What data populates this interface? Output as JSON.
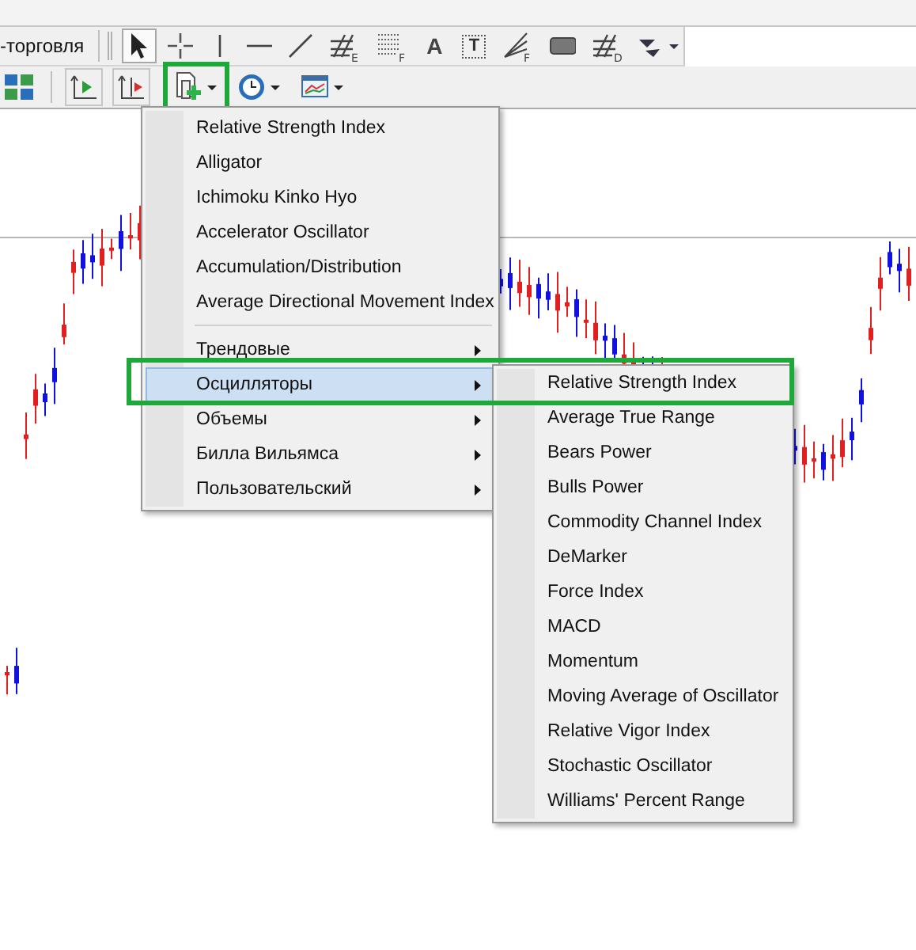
{
  "toolbar_top": {
    "label": "-торговля",
    "tools": [
      {
        "kind": "cursor",
        "selected": true
      },
      {
        "kind": "crosshair",
        "selected": false
      },
      {
        "kind": "vline",
        "selected": false
      },
      {
        "kind": "hline",
        "selected": false
      },
      {
        "kind": "trendline",
        "selected": false
      },
      {
        "kind": "channel",
        "glyph": "E",
        "selected": false
      },
      {
        "kind": "levels",
        "glyph": "F",
        "selected": false
      },
      {
        "kind": "text",
        "glyph": "A",
        "selected": false
      },
      {
        "kind": "label",
        "glyph": "T",
        "selected": false
      },
      {
        "kind": "fan",
        "glyph": "F",
        "selected": false
      },
      {
        "kind": "rect",
        "selected": false
      },
      {
        "kind": "grid",
        "glyph": "D",
        "selected": false
      },
      {
        "kind": "shapes",
        "selected": false
      }
    ]
  },
  "toolbar_bottom": {
    "tools": [
      {
        "kind": "tiles",
        "highlighted": false
      },
      {
        "kind": "autoscroll",
        "highlighted": false
      },
      {
        "kind": "shift",
        "highlighted": false
      },
      {
        "kind": "indicators",
        "highlighted": true
      },
      {
        "kind": "periods",
        "highlighted": false
      },
      {
        "kind": "templates",
        "highlighted": false
      }
    ]
  },
  "menu": {
    "items": [
      {
        "kind": "item",
        "label": "Relative Strength Index",
        "selected": false,
        "highlighted": false
      },
      {
        "kind": "item",
        "label": "Alligator",
        "selected": false,
        "highlighted": false
      },
      {
        "kind": "item",
        "label": "Ichimoku Kinko Hyo",
        "selected": false,
        "highlighted": false
      },
      {
        "kind": "item",
        "label": "Accelerator Oscillator",
        "selected": false,
        "highlighted": false
      },
      {
        "kind": "item",
        "label": "Accumulation/Distribution",
        "selected": false,
        "highlighted": false
      },
      {
        "kind": "item",
        "label": "Average Directional Movement Index",
        "selected": false,
        "highlighted": false
      },
      {
        "kind": "separator"
      },
      {
        "kind": "submenu",
        "label": "Трендовые",
        "selected": false,
        "highlighted": false
      },
      {
        "kind": "submenu",
        "label": "Осцилляторы",
        "selected": true,
        "highlighted": true
      },
      {
        "kind": "submenu",
        "label": "Объемы",
        "selected": false,
        "highlighted": false
      },
      {
        "kind": "submenu",
        "label": "Билла Вильямса",
        "selected": false,
        "highlighted": false
      },
      {
        "kind": "submenu",
        "label": "Пользовательский",
        "selected": false,
        "highlighted": false
      }
    ]
  },
  "submenu": {
    "items": [
      {
        "label": "Relative Strength Index",
        "selected": false
      },
      {
        "label": "Average True Range",
        "selected": false
      },
      {
        "label": "Bears Power",
        "selected": false
      },
      {
        "label": "Bulls Power",
        "selected": false
      },
      {
        "label": "Commodity Channel Index",
        "selected": false
      },
      {
        "label": "DeMarker",
        "selected": false
      },
      {
        "label": "Force Index",
        "selected": false
      },
      {
        "label": "MACD",
        "selected": false
      },
      {
        "label": "Momentum",
        "selected": false
      },
      {
        "label": "Moving Average of Oscillator",
        "selected": false
      },
      {
        "label": "Relative Vigor Index",
        "selected": false
      },
      {
        "label": "Stochastic Oscillator",
        "selected": false
      },
      {
        "label": "Williams' Percent Range",
        "selected": false
      }
    ]
  }
}
